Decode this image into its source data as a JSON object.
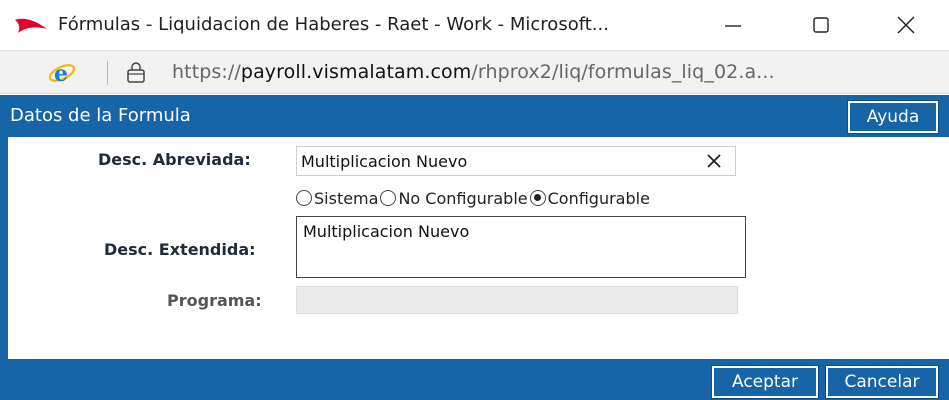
{
  "window": {
    "title": "Fórmulas - Liquidacion de Haberes - Raet - Work - Microsoft...",
    "logo_icon": "app-logo-icon",
    "controls": {
      "minimize_icon": "minimize-icon",
      "maximize_icon": "maximize-icon",
      "close_icon": "close-icon"
    }
  },
  "address_bar": {
    "browser_icon": "ie-icon",
    "lock_icon": "lock-icon",
    "url_scheme": "https://",
    "url_host": "payroll.vismalatam.com",
    "url_path": "/rhprox2/liq/formulas_liq_02.a..."
  },
  "header": {
    "title": "Datos de la Formula",
    "help_label": "Ayuda"
  },
  "form": {
    "short_desc": {
      "label": "Desc. Abreviada:",
      "value": "Multiplicacion Nuevo",
      "clear_icon": "clear-icon"
    },
    "type_options": [
      {
        "label": "Sistema",
        "checked": false
      },
      {
        "label": "No Configurable",
        "checked": false
      },
      {
        "label": "Configurable",
        "checked": true
      }
    ],
    "long_desc": {
      "label": "Desc. Extendida:",
      "value": "Multiplicacion Nuevo"
    },
    "program": {
      "label": "Programa:",
      "value": ""
    }
  },
  "footer": {
    "accept_label": "Aceptar",
    "cancel_label": "Cancelar"
  },
  "colors": {
    "primary": "#1565a8",
    "logo_red": "#e4002b"
  }
}
